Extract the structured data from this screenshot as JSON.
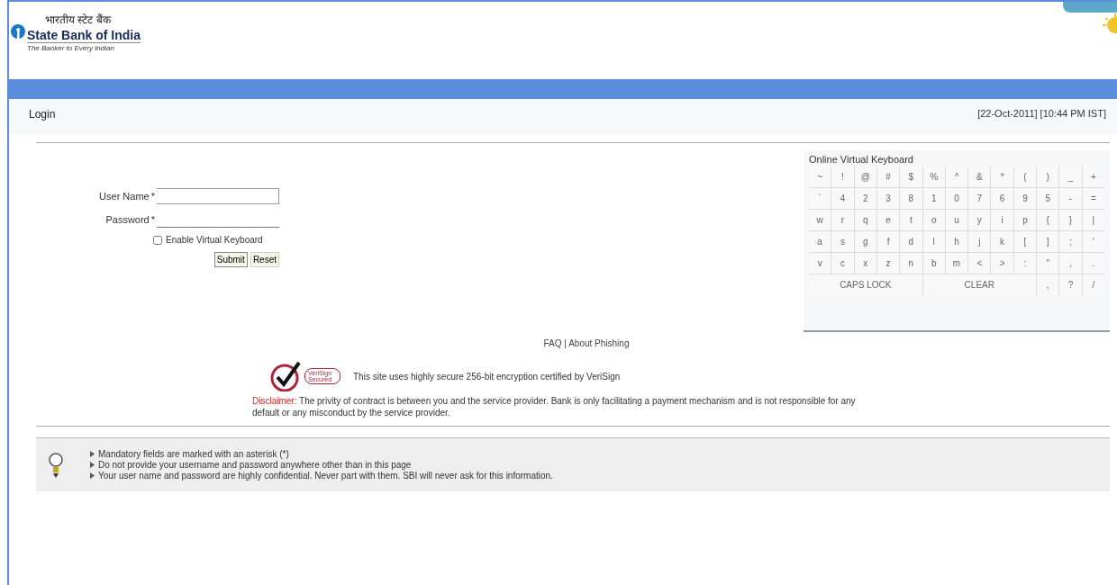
{
  "header": {
    "hindi_name": "भारतीय स्टेट बैंक",
    "bank_name": "State Bank of India",
    "tagline": "The Banker to Every Indian"
  },
  "page_title": "Login",
  "datetime": "[22-Oct-2011] [10:44 PM IST]",
  "form": {
    "fields": [
      {
        "label": "User Name",
        "required": "*",
        "kind": "text"
      },
      {
        "label": "Password",
        "required": "*",
        "kind": "password"
      }
    ],
    "virtual_keyboard_toggle": {
      "label": "Enable Virtual Keyboard",
      "checked": false
    },
    "buttons": [
      "Submit",
      "Reset"
    ]
  },
  "keyboard": {
    "title": "Online Virtual Keyboard",
    "rows": [
      [
        "~",
        "!",
        "@",
        "#",
        "$",
        "%",
        "^",
        "&",
        "*",
        "(",
        ")",
        "_",
        "+"
      ],
      [
        "`",
        "4",
        "2",
        "3",
        "8",
        "1",
        "0",
        "7",
        "6",
        "9",
        "5",
        "-",
        "="
      ],
      [
        "w",
        "r",
        "q",
        "e",
        "t",
        "o",
        "u",
        "y",
        "i",
        "p",
        "{",
        "}",
        "|"
      ],
      [
        "a",
        "s",
        "g",
        "f",
        "d",
        "l",
        "h",
        "j",
        "k",
        "[",
        "]",
        ";",
        "'"
      ],
      [
        "v",
        "c",
        "x",
        "z",
        "n",
        "b",
        "m",
        "<",
        ">",
        ":",
        "\"",
        ",",
        "."
      ]
    ],
    "bottom_keys": [
      {
        "label": "CAPS LOCK",
        "kind": "wide"
      },
      {
        "label": "CLEAR",
        "kind": "wide"
      },
      {
        "label": ",",
        "kind": "key"
      },
      {
        "label": "?",
        "kind": "key"
      },
      {
        "label": "/",
        "kind": "key"
      }
    ]
  },
  "links": [
    "FAQ",
    "|",
    "About Phishing"
  ],
  "security_note": "This site uses highly secure 256-bit encryption certified by VeriSign",
  "seal_text": "VeriSign Secured",
  "disclaimer": {
    "label": "Disclaimer:",
    "text": "The privity of contract is between you and the service provider. Bank is only facilitating a payment mechanism and is not responsible for any default or any misconduct by the service provider."
  },
  "tips": [
    "Mandatory fields are marked with an asterisk (*)",
    "Do not provide your username and password anywhere other than in this page",
    "Your user name and password are highly confidential. Never part with them. SBI will never ask for this information."
  ]
}
